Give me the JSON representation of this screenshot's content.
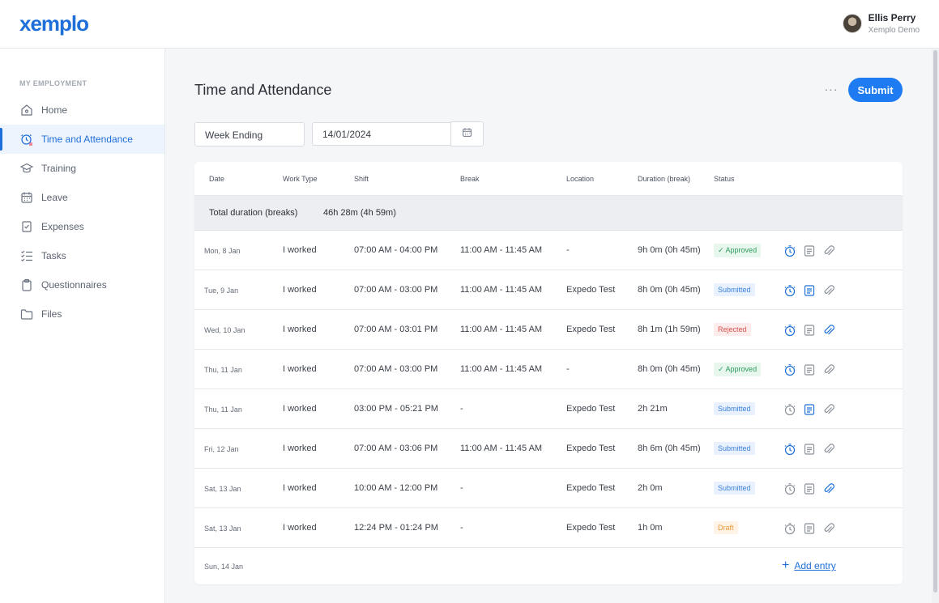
{
  "brand": {
    "logo": "xemplo"
  },
  "user": {
    "name": "Ellis Perry",
    "org": "Xemplo Demo"
  },
  "sidebar": {
    "section": "MY EMPLOYMENT",
    "items": [
      {
        "label": "Home",
        "icon": "home-icon"
      },
      {
        "label": "Time and Attendance",
        "icon": "clock-icon",
        "active": true
      },
      {
        "label": "Training",
        "icon": "graduation-cap-icon"
      },
      {
        "label": "Leave",
        "icon": "calendar-icon"
      },
      {
        "label": "Expenses",
        "icon": "receipt-icon"
      },
      {
        "label": "Tasks",
        "icon": "checklist-icon"
      },
      {
        "label": "Questionnaires",
        "icon": "clipboard-icon"
      },
      {
        "label": "Files",
        "icon": "folder-icon"
      }
    ]
  },
  "page": {
    "title": "Time and Attendance",
    "more": "···",
    "submit": "Submit",
    "filter": "Week Ending",
    "date": "14/01/2024"
  },
  "table": {
    "headers": [
      "Date",
      "Work Type",
      "Shift",
      "Break",
      "Location",
      "Duration (break)",
      "Status"
    ],
    "totals_label": "Total duration (breaks)",
    "totals_value": "46h 28m (4h 59m)",
    "rows": [
      {
        "date": "Mon, 8 Jan",
        "work": "I worked",
        "shift": "07:00 AM - 04:00 PM",
        "break": "11:00 AM - 11:45 AM",
        "location": "-",
        "duration": "9h 0m (0h 45m)",
        "status": "✓ Approved",
        "kind": "approved"
      },
      {
        "date": "Tue, 9 Jan",
        "work": "I worked",
        "shift": "07:00 AM - 03:00 PM",
        "break": "11:00 AM - 11:45 AM",
        "location": "Expedo Test",
        "duration": "8h 0m (0h 45m)",
        "status": "Submitted",
        "kind": "submitted"
      },
      {
        "date": "Wed, 10 Jan",
        "work": "I worked",
        "shift": "07:00 AM - 03:01 PM",
        "break": "11:00 AM - 11:45 AM",
        "location": "Expedo Test",
        "duration": "8h 1m (1h 59m)",
        "status": "Rejected",
        "kind": "rejected"
      },
      {
        "date": "Thu, 11 Jan",
        "work": "I worked",
        "shift": "07:00 AM - 03:00 PM",
        "break": "11:00 AM - 11:45 AM",
        "location": "-",
        "duration": "8h 0m (0h 45m)",
        "status": "✓ Approved",
        "kind": "approved"
      },
      {
        "date": "Thu, 11 Jan",
        "work": "I worked",
        "shift": "03:00 PM - 05:21 PM",
        "break": "-",
        "location": "Expedo Test",
        "duration": "2h 21m",
        "status": "Submitted",
        "kind": "submitted"
      },
      {
        "date": "Fri, 12 Jan",
        "work": "I worked",
        "shift": "07:00 AM - 03:06 PM",
        "break": "11:00 AM - 11:45 AM",
        "location": "Expedo Test",
        "duration": "8h 6m (0h 45m)",
        "status": "Submitted",
        "kind": "submitted"
      },
      {
        "date": "Sat, 13 Jan",
        "work": "I worked",
        "shift": "10:00 AM - 12:00 PM",
        "break": "-",
        "location": "Expedo Test",
        "duration": "2h 0m",
        "status": "Submitted",
        "kind": "submitted"
      },
      {
        "date": "Sat, 13 Jan",
        "work": "I worked",
        "shift": "12:24 PM - 01:24 PM",
        "break": "-",
        "location": "Expedo Test",
        "duration": "1h 0m",
        "status": "Draft",
        "kind": "draft"
      }
    ],
    "last_date": "Sun, 14 Jan",
    "add_entry": "Add entry"
  },
  "colors": {
    "accent": "#1e6fd9",
    "button": "#1e7bf2"
  }
}
